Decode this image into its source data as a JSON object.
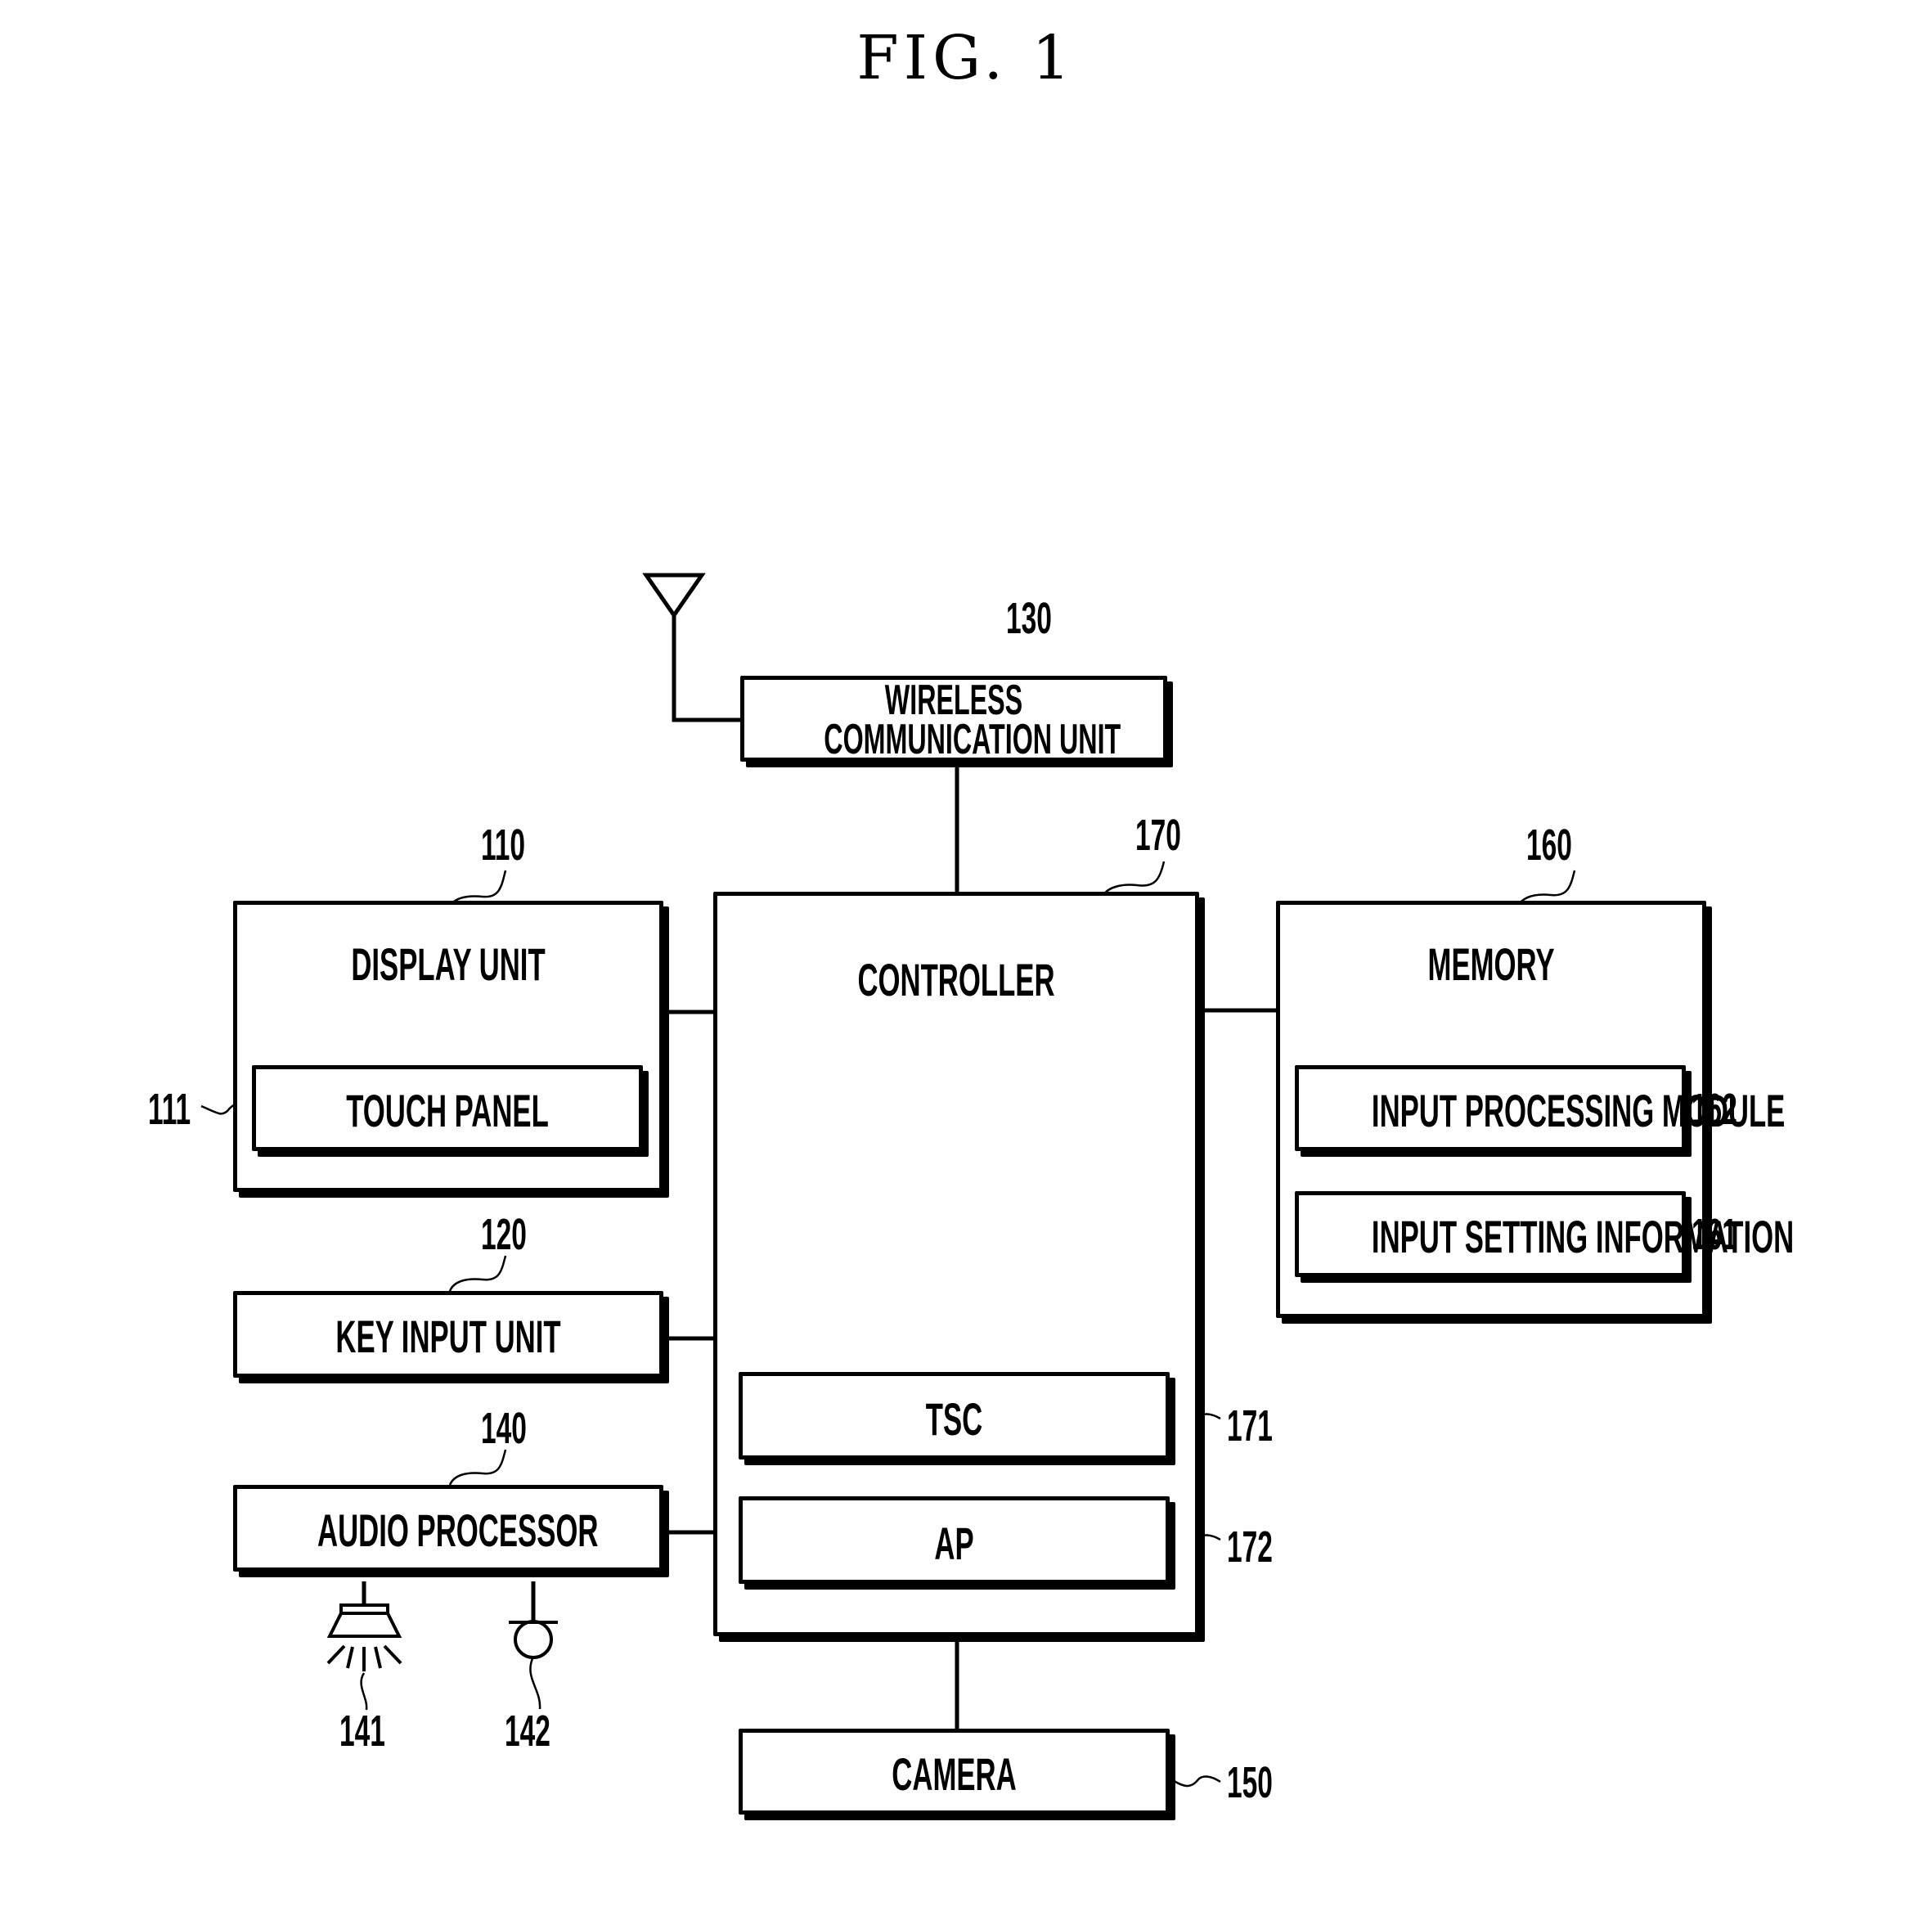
{
  "figure": {
    "title": "FIG. 1"
  },
  "blocks": {
    "wireless": {
      "line1": "WIRELESS",
      "line2": "COMMUNICATION UNIT",
      "ref": "130"
    },
    "controller": {
      "label": "CONTROLLER",
      "ref": "170"
    },
    "tsc": {
      "label": "TSC",
      "ref": "171"
    },
    "ap": {
      "label": "AP",
      "ref": "172"
    },
    "display": {
      "label": "DISPLAY UNIT",
      "ref": "110"
    },
    "touch_panel": {
      "label": "TOUCH PANEL",
      "ref": "111"
    },
    "key_input": {
      "label": "KEY INPUT UNIT",
      "ref": "120"
    },
    "audio": {
      "label": "AUDIO PROCESSOR",
      "ref": "140"
    },
    "speaker": {
      "ref": "141",
      "icon": "speaker-icon"
    },
    "microphone": {
      "ref": "142",
      "icon": "microphone-icon"
    },
    "camera": {
      "label": "CAMERA",
      "ref": "150"
    },
    "memory": {
      "label": "MEMORY",
      "ref": "160"
    },
    "input_processing": {
      "label": "INPUT PROCESSING MODULE",
      "ref": "162"
    },
    "input_setting": {
      "label": "INPUT SETTING INFORMATION",
      "ref": "161"
    },
    "antenna": {
      "icon": "antenna-icon"
    }
  }
}
